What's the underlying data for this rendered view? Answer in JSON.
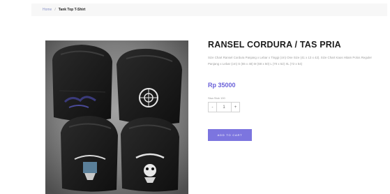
{
  "breadcrumb": {
    "home": "Home",
    "separator": "/",
    "current": "Tank Top T-Shirt"
  },
  "product": {
    "title": "RANSEL CORDURA / TAS PRIA",
    "description": "Size Chart Ransel Cordura Panjang x Lebar x Tinggi (cm) One Size (41 x 13 x 42). Size Chart Kaos Hitam Polos Reguler Panjang x Lebar (cm) S (65 x 48) M (68 x 50) L (70 x 52) XL (72 x 54)",
    "price": "Rp 35000",
    "stock_label": "Sisa Stok 100",
    "quantity": "1",
    "decrement_label": "-",
    "increment_label": "+",
    "add_to_cart_label": "ADD TO CART"
  },
  "colors": {
    "accent": "#7c75df",
    "price": "#6b62d9",
    "link": "#8a93c8"
  }
}
